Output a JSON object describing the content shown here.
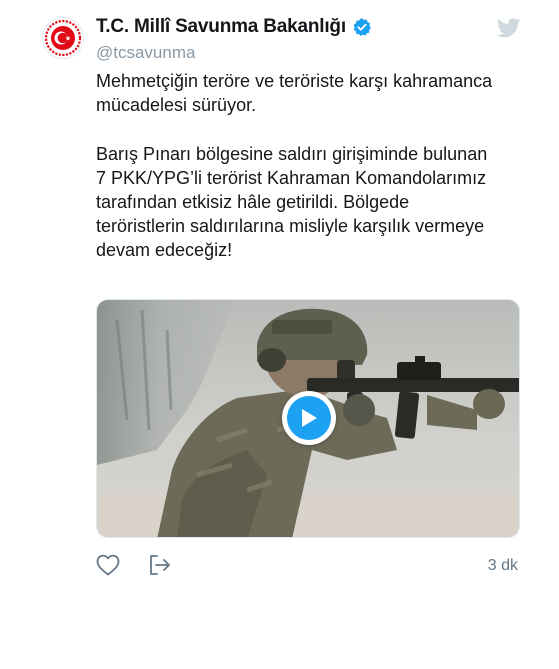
{
  "account": {
    "display_name": "T.C. Millî Savunma Bakanlığı",
    "handle": "@tcsavunma",
    "verified": true,
    "avatar_icon": "turkish-mod-emblem-icon"
  },
  "tweet": {
    "paragraph1_lines": [
      "Mehmetçiğin teröre ve teröriste karşı kahramanca",
      "mücadelesi sürüyor."
    ],
    "paragraph2_lines": [
      "Barış Pınarı bölgesine saldırı girişiminde bulunan",
      "7 PKK/YPG’li terörist Kahraman Komandolarımız",
      "tarafından etkisiz hâle getirildi. Bölgede",
      "teröristlerin saldırılarına misliyle karşılık vermeye",
      "devam edeceğiz!"
    ],
    "media_type": "video",
    "timestamp": "3 dk"
  },
  "icons": {
    "platform": "twitter-bird-icon",
    "verified": "verified-badge-icon",
    "play": "play-icon",
    "like": "heart-icon",
    "share": "share-icon"
  },
  "colors": {
    "accent": "#1da1f2",
    "text": "#14171a",
    "secondary": "#8899a6",
    "bird": "#cfd9de",
    "emblem": "#e30a17"
  }
}
